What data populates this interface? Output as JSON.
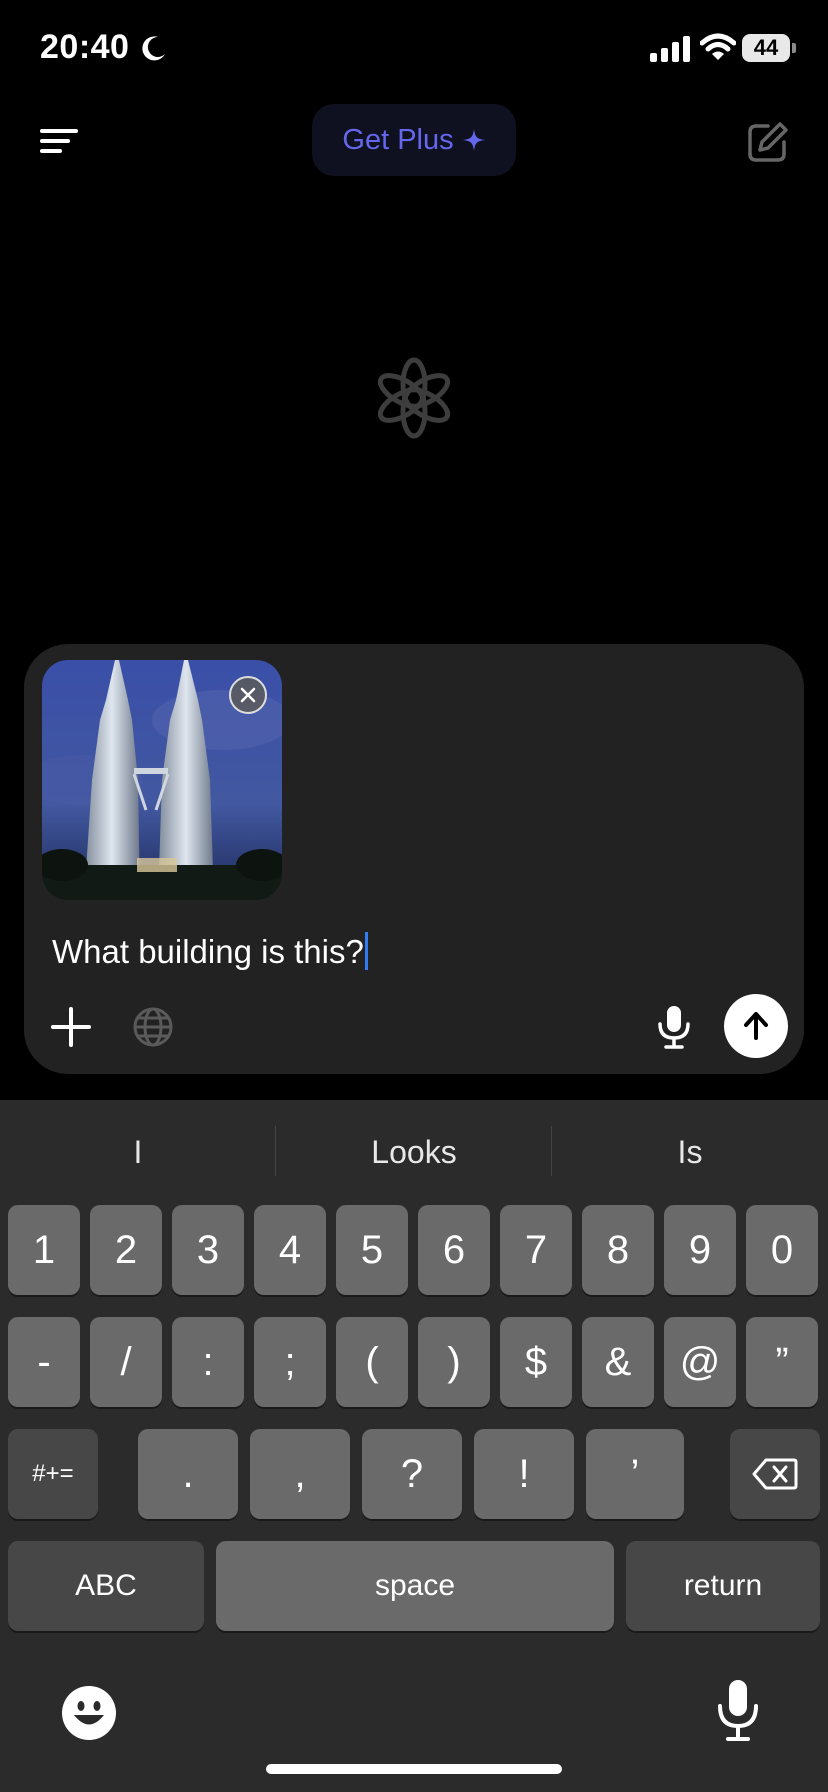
{
  "status_bar": {
    "time": "20:40",
    "battery": "44",
    "icons": [
      "moon-icon",
      "signal-icon",
      "wifi-icon",
      "battery-icon"
    ]
  },
  "header": {
    "get_plus_label": "Get Plus",
    "get_plus_icon": "sparkle-icon",
    "menu_icon": "menu-icon",
    "compose_icon": "compose-icon"
  },
  "logo_icon": "openai-logo-icon",
  "composer": {
    "attachment_icon": "photo-thumbnail",
    "text": "What building is this?",
    "buttons": [
      "plus-icon",
      "globe-icon",
      "microphone-icon",
      "arrow-up-icon"
    ]
  },
  "keyboard": {
    "suggestions": [
      "I",
      "Looks",
      "Is"
    ],
    "row1": [
      "1",
      "2",
      "3",
      "4",
      "5",
      "6",
      "7",
      "8",
      "9",
      "0"
    ],
    "row2": [
      "-",
      "/",
      ":",
      ";",
      "(",
      ")",
      "$",
      "&",
      "@",
      "”"
    ],
    "row3": [
      "#+=",
      ".",
      ",",
      "?",
      "!",
      "’"
    ],
    "abc": "ABC",
    "space": "space",
    "return": "return",
    "bottom_icons": [
      "emoji-icon",
      "dictation-icon"
    ]
  },
  "colors": {
    "background": "#000000",
    "accent": "#6466ec",
    "composer": "#222222",
    "caret": "#2f7cf6",
    "keyboard": "#2b2b2b"
  }
}
